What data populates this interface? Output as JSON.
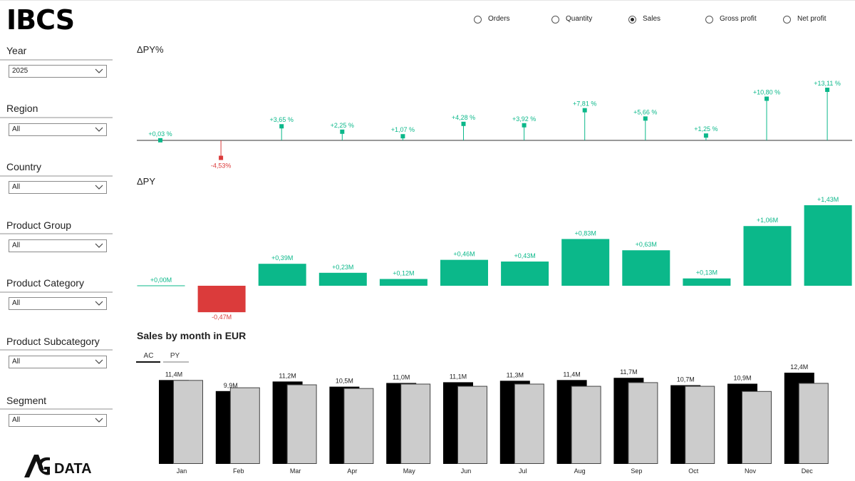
{
  "app": {
    "title": "IBCS"
  },
  "filters": [
    {
      "label": "Year",
      "value": "2025"
    },
    {
      "label": "Region",
      "value": "All"
    },
    {
      "label": "Country",
      "value": "All"
    },
    {
      "label": "Product Group",
      "value": "All"
    },
    {
      "label": "Product Category",
      "value": "All"
    },
    {
      "label": "Product Subcategory",
      "value": "All"
    },
    {
      "label": "Segment",
      "value": "All"
    }
  ],
  "measure_selector": {
    "options": [
      "Orders",
      "Quantity",
      "Sales",
      "Gross profit",
      "Net profit"
    ],
    "selected": "Sales"
  },
  "logo": {
    "text": "DATA",
    "mark": "AG"
  },
  "colors": {
    "positive": "#0bb88a",
    "negative": "#db3b3b",
    "ac": "#000000",
    "py": "#cccccc"
  },
  "sections": {
    "dpy_pct_title": "ΔPY%",
    "dpy_title": "ΔPY",
    "sales_title": "Sales by month in EUR"
  },
  "chart_data": [
    {
      "type": "bar",
      "title": "ΔPY%",
      "categories": [
        "Jan",
        "Feb",
        "Mar",
        "Apr",
        "May",
        "Jun",
        "Jul",
        "Aug",
        "Sep",
        "Oct",
        "Nov",
        "Dec"
      ],
      "values": [
        0.03,
        -4.53,
        3.65,
        2.25,
        1.07,
        4.28,
        3.92,
        7.81,
        5.66,
        1.25,
        10.8,
        13.11
      ],
      "labels": [
        "+0,03 %",
        "-4,53%",
        "+3,65 %",
        "+2,25 %",
        "+1,07 %",
        "+4,28 %",
        "+3,92 %",
        "+7,81 %",
        "+5,66 %",
        "+1,25 %",
        "+10,80 %",
        "+13,11 %"
      ]
    },
    {
      "type": "bar",
      "title": "ΔPY",
      "categories": [
        "Jan",
        "Feb",
        "Mar",
        "Apr",
        "May",
        "Jun",
        "Jul",
        "Aug",
        "Sep",
        "Oct",
        "Nov",
        "Dec"
      ],
      "values": [
        0.0,
        -0.47,
        0.39,
        0.23,
        0.12,
        0.46,
        0.43,
        0.83,
        0.63,
        0.13,
        1.06,
        1.43
      ],
      "labels": [
        "+0,00M",
        "-0,47M",
        "+0,39M",
        "+0,23M",
        "+0,12M",
        "+0,46M",
        "+0,43M",
        "+0,83M",
        "+0,63M",
        "+0,13M",
        "+1,06M",
        "+1,43M"
      ]
    },
    {
      "type": "bar",
      "title": "Sales by month in EUR",
      "categories": [
        "Jan",
        "Feb",
        "Mar",
        "Apr",
        "May",
        "Jun",
        "Jul",
        "Aug",
        "Sep",
        "Oct",
        "Nov",
        "Dec"
      ],
      "legend": [
        "AC",
        "PY"
      ],
      "series": [
        {
          "name": "AC",
          "values": [
            11.4,
            9.9,
            11.2,
            10.5,
            11.0,
            11.1,
            11.3,
            11.4,
            11.7,
            10.7,
            10.9,
            12.4
          ]
        },
        {
          "name": "PY",
          "values": [
            11.4,
            10.4,
            10.8,
            10.3,
            10.9,
            10.6,
            10.9,
            10.6,
            11.1,
            10.6,
            9.9,
            11.0
          ]
        }
      ],
      "ac_labels": [
        "11,4M",
        "9,9M",
        "11,2M",
        "10,5M",
        "11,0M",
        "11,1M",
        "11,3M",
        "11,4M",
        "11,7M",
        "10,7M",
        "10,9M",
        "12,4M"
      ]
    }
  ]
}
